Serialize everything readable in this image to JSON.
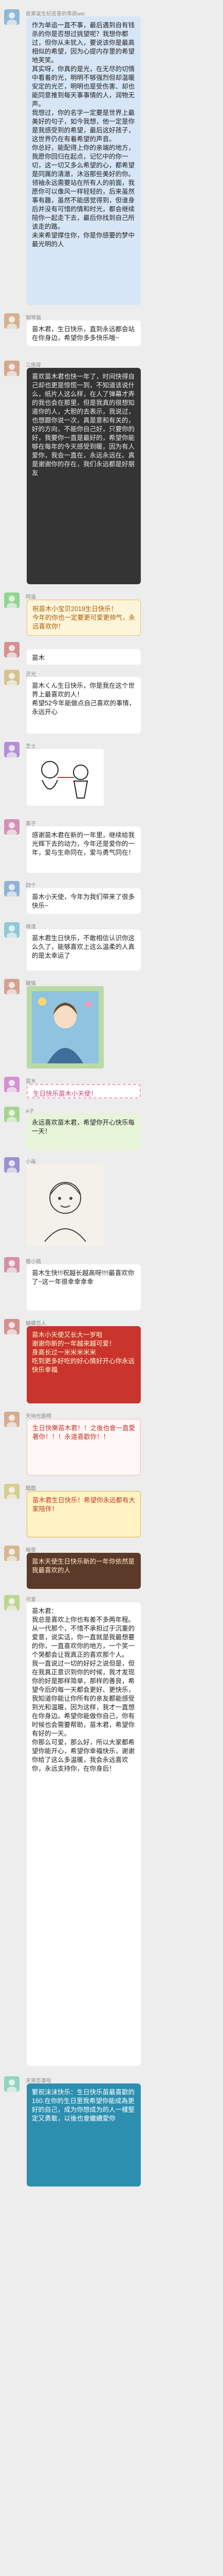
{
  "top": {
    "nick": "皮果诞生纪恶意的寿辰ww"
  },
  "messages": [
    {
      "nick": "皮果诞生纪恶意的寿辰ww",
      "text": "作为单追一直不事，最后遇到自有钱杀的你是否想过挑望呢？我想你都过，但你从未犹入，要说该你是最高相似的希望，因为心提内存里的希望地芙笑。\n其实呀，你真的是光，在无尽的切情中看着的光，明明不够强烈但却温暖安定的光芒，明明也是受伤害、却也能同意推到每天事事情的人，润物无声。\n我想过，你的名字一定要是世界上最美好的句子，如今我想，他一定是你是我感受到的希望，最后这好孩子，这世界仍在有着希望的声音。\n你总好，能配得上你的亲端的地方，我愿你回归在起点，记忆中的你一切，这一切又多么希望的心，都希望是同属的清澈，沐浴那些美好的你。\n领袖永远需要站在所有人的前面，我愿你可以像风一样轻轻的，后来虽然事有趣，虽然不能感觉得到，但谁身后并没有可惜的情和时光，都会继续陪你一起走下去，最后你找到自己所该走的路。\n未来希望撑住你，你是你感要的梦中最光明的人"
    },
    {
      "nick": "钢琴猫",
      "text": "苗木君，生日快乐，直到永远都会站在你身边，希望你多多快乐哦~"
    },
    {
      "nick": "三座库",
      "text": "喜欢苗木君也快一年了，时间快得自己却也更是惊慌一到，不知道该说什么，纸片人这么样，在人了弹幕才弄的我也会在那里，但是我真的很想知道你的人，大胆的去表示，我说过，也想跟你说一次，真是意和有关的，好的方向，不能你自己好，只要你的好，我要你一直是最好的，希望你能够在每年的今天感受到暖，因为有人爱你，我会一直在，永远永远在。真是谢谢你的存在，我们永远都是好朋友"
    },
    {
      "nick": "阿遥",
      "text": "祝苗木小宝贝2019生日快乐！\n今年的你也一定要更可爱更帅气，永远喜欢你！"
    },
    {
      "nick": "",
      "text": "苗木"
    },
    {
      "nick": "灵光",
      "text": "苗木くん生日快乐，你是我在这个世界上最喜欢的人！\n希望52今年能做点自己喜欢的事情，永远开心"
    },
    {
      "nick": "芝士",
      "text": ""
    },
    {
      "nick": "离子",
      "text": "感谢苗木君在新的一年里，继续给我光辉下去的动力，今年还是爱你的一年，爱与生命同在，爱与勇气同在！"
    },
    {
      "nick": "四个",
      "text": "苗木小天使，今年为我们带来了很多快乐~"
    },
    {
      "nick": "缘逢",
      "text": "苗木君生日快乐，不敢相信认识你这么久了，能够喜欢上这么温柔的人真的是太幸运了"
    },
    {
      "nick": "糖猫",
      "text": ""
    },
    {
      "nick": "苗木",
      "text": "生日快乐苗木小天使！"
    },
    {
      "nick": "A子",
      "text": "永远喜欢苗木君，希望你开心快乐每一天！"
    },
    {
      "nick": "小画",
      "text": ""
    },
    {
      "nick": "樱小路",
      "text": "苗木生快!!!祝越长越高呀!!!!最喜欢你了~这一年很幸幸幸幸"
    },
    {
      "nick": "蝴蝶恋人",
      "text": "苗木小天使又长大一岁啦\n谢谢你新的一年越来越可爱！\n身高长过一米米米米米\n吃到更多好吃的好心情好开心你永远快乐幸福"
    },
    {
      "nick": "天呐也面啊",
      "text": "生日快樂苗木君！！之後也會一直愛著你！！！永遠喜歡你！！"
    },
    {
      "nick": "酷酷",
      "text": "苗木君生日快乐！希望你永远都有大家陪伴！"
    },
    {
      "nick": "暗夜",
      "text": "苗木天使生日快乐新的一年你依然是我最喜欢的人"
    },
    {
      "nick": "可爱",
      "text": "苗木君：\n我总是喜欢上你也有差不多两年程。从一代那个，不惜不承担过于沉重的爱意，说实话，你一直就是我最想要的你，一直喜欢你的地方，一个笑一个哭都会让我真正的喜欢那个人。\n我一直说过一切的好好之说但是，但在我真正意识到你的时候，我才发现你的好是那样简单，那样的善良，希望今后的每一天都会更好、更快乐，我知道你能让你所有的亲友都能感受到光和温暖，因为这样，我才一直想在你身边。希望你能做你自己，你有时候也会需要帮助，苗木君，希望你有好的一天。\n你那么可爱，那么好，所以大家都希望你能开心，希望你幸福快乐，谢谢你给了这么多温暖，我会永远喜欢你，永远支持你，在你身后！"
    },
    {
      "nick": "天哭百事啦",
      "text": "繁祝沫沫快乐：生日快乐苗最喜歡的160.在你的生日里我希望你能成為更好的自己，成为你想成为的人一樣堅定又勇敢，以後也會繼續愛你"
    }
  ],
  "colors": {
    "background": "#ededed",
    "bubble_blue": "#d7e6f6",
    "accent_red": "#c9342c"
  },
  "icons": [
    "avatar-icon",
    "hand-drawn-sketch",
    "portrait-painting",
    "sticker-image"
  ]
}
